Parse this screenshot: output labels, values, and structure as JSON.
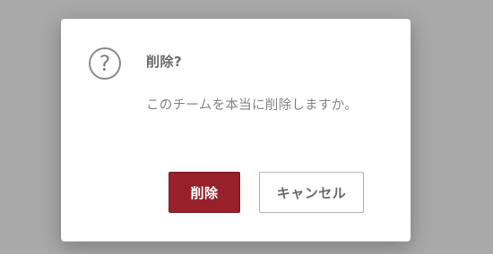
{
  "dialog": {
    "icon": "question-circle-icon",
    "icon_glyph": "?",
    "title": "削除?",
    "message": "このチームを本当に削除しますか。",
    "buttons": {
      "delete_label": "削除",
      "cancel_label": "キャンセル"
    }
  },
  "colors": {
    "overlay": "#a9a9a9",
    "primary_button": "#98202a",
    "dialog_background": "#ffffff"
  }
}
